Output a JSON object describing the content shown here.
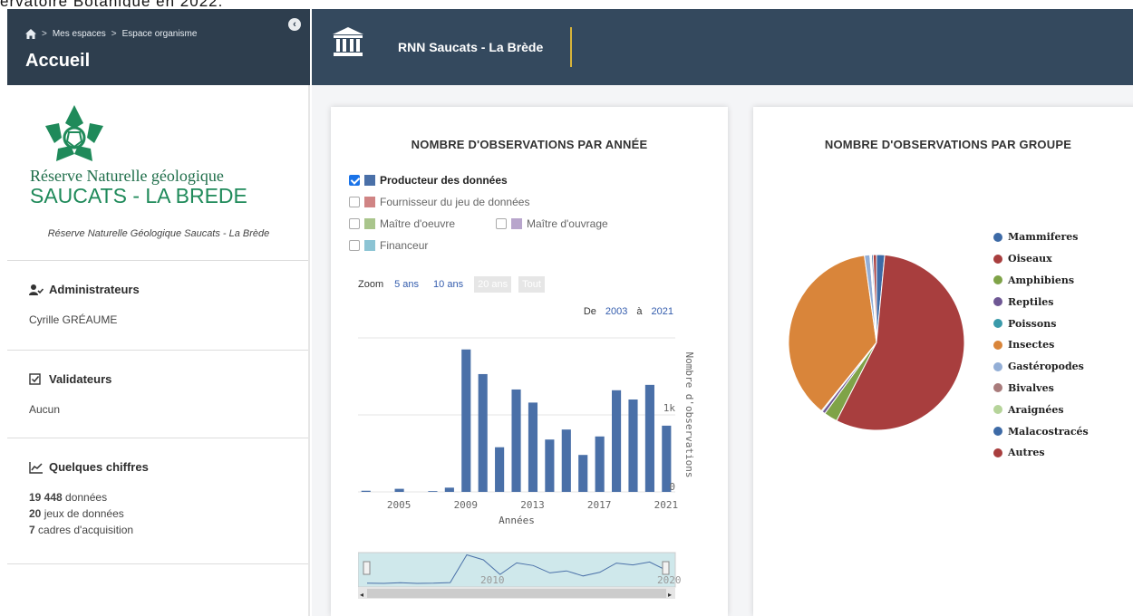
{
  "top_snippet": "ervatoire Botanique en 2022.",
  "header": {
    "breadcrumb": [
      "Mes espaces",
      "Espace organisme"
    ],
    "breadcrumb_sep": ">",
    "page_title": "Accueil",
    "space_name": "RNN Saucats - La Brède"
  },
  "sidebar": {
    "logo_line1": "Réserve Naturelle géologique",
    "logo_line2": "SAUCATS - LA BREDE",
    "org_name": "Réserve Naturelle Géologique Saucats - La Brède",
    "admins_title": "Administrateurs",
    "admins_value": "Cyrille GRÉAUME",
    "validators_title": "Validateurs",
    "validators_value": "Aucun",
    "figures_title": "Quelques chiffres",
    "figures": [
      {
        "num": "19 448",
        "label": " données"
      },
      {
        "num": "20",
        "label": " jeux de données"
      },
      {
        "num": "7",
        "label": " cadres d'acquisition"
      }
    ]
  },
  "panel1": {
    "title": "NOMBRE D'OBSERVATIONS PAR ANNÉE",
    "legend": [
      {
        "label": "Producteur des données",
        "color": "#4a70a8",
        "checked": true
      },
      {
        "label": "Fournisseur du jeu de données",
        "color": "#d08484",
        "checked": false
      },
      {
        "label": "Maître d'oeuvre",
        "color": "#a9c58c",
        "checked": false
      },
      {
        "label": "Maître d'ouvrage",
        "color": "#b8a5cc",
        "checked": false
      },
      {
        "label": "Financeur",
        "color": "#8cc4d4",
        "checked": false
      }
    ],
    "zoom_label": "Zoom",
    "zoom_buttons": [
      "5 ans",
      "10 ans",
      "20 ans",
      "Tout"
    ],
    "range_from_label": "De",
    "range_from": "2003",
    "range_to_label": "à",
    "range_to": "2021",
    "nav_labels": [
      "2010",
      "2020"
    ]
  },
  "chart_data": {
    "type": "bar",
    "title": "NOMBRE D'OBSERVATIONS PAR ANNÉE",
    "xlabel": "Années",
    "ylabel": "Nombre d'observations",
    "x": [
      2003,
      2004,
      2005,
      2006,
      2007,
      2008,
      2009,
      2010,
      2011,
      2012,
      2013,
      2014,
      2015,
      2016,
      2017,
      2018,
      2019,
      2020,
      2021
    ],
    "values": [
      15,
      0,
      40,
      0,
      10,
      55,
      1850,
      1530,
      580,
      1330,
      1160,
      680,
      810,
      480,
      720,
      1320,
      1200,
      1390,
      860
    ],
    "series_name": "Producteur des données",
    "color": "#4a70a8",
    "x_ticks": [
      "2005",
      "2009",
      "2013",
      "2017",
      "2021"
    ],
    "y_ticks": [
      "0",
      "1k"
    ],
    "ylim": [
      0,
      2000
    ]
  },
  "panel2": {
    "title": "NOMBRE D'OBSERVATIONS PAR GROUPE"
  },
  "pie_data": {
    "type": "pie",
    "title": "NOMBRE D'OBSERVATIONS PAR GROUPE",
    "slices": [
      {
        "label": "Mammiferes",
        "value": 1.5,
        "color": "#3d6aa6"
      },
      {
        "label": "Oiseaux",
        "value": 56.0,
        "color": "#a83e3e"
      },
      {
        "label": "Amphibiens",
        "value": 2.5,
        "color": "#7fa348"
      },
      {
        "label": "Reptiles",
        "value": 0.6,
        "color": "#6e5794"
      },
      {
        "label": "Poissons",
        "value": 0.2,
        "color": "#3a9aaa"
      },
      {
        "label": "Insectes",
        "value": 37.0,
        "color": "#d9853a"
      },
      {
        "label": "Gastéropodes",
        "value": 1.0,
        "color": "#93aed6"
      },
      {
        "label": "Bivalves",
        "value": 0.1,
        "color": "#a97b7b"
      },
      {
        "label": "Araignées",
        "value": 0.2,
        "color": "#b6d49a"
      },
      {
        "label": "Malacostracés",
        "value": 0.3,
        "color": "#3d6aa6"
      },
      {
        "label": "Autres",
        "value": 0.6,
        "color": "#a83e3e"
      }
    ]
  }
}
